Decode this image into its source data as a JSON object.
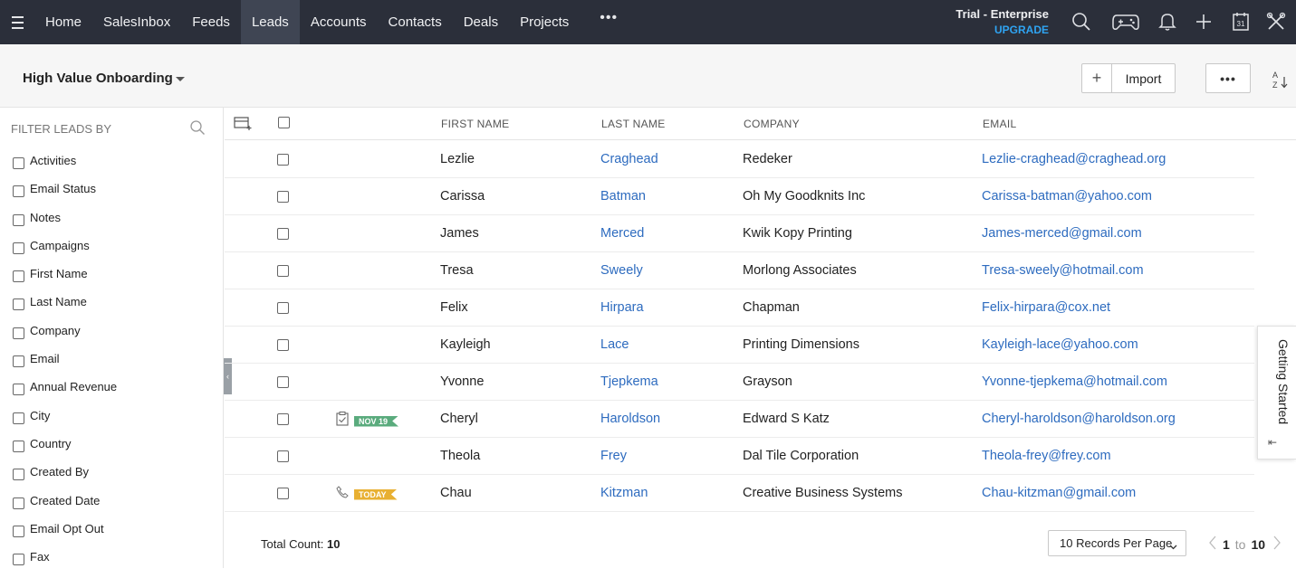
{
  "nav": {
    "items": [
      "Home",
      "SalesInbox",
      "Feeds",
      "Leads",
      "Accounts",
      "Contacts",
      "Deals",
      "Projects"
    ],
    "active": "Leads",
    "more": "•••",
    "trial_label": "Trial - Enterprise",
    "upgrade_label": "UPGRADE",
    "icons": [
      "search-icon",
      "gamepad-icon",
      "bell-icon",
      "plus-icon",
      "calendar-icon",
      "tools-icon"
    ],
    "calendar_day": "31"
  },
  "subheader": {
    "view_name": "High Value Onboarding",
    "plus_label": "+",
    "import_label": "Import",
    "more_label": "•••",
    "sort_top": "A",
    "sort_bottom": "Z"
  },
  "sidebar": {
    "title": "FILTER LEADS BY",
    "filters": [
      "Activities",
      "Email Status",
      "Notes",
      "Campaigns",
      "First Name",
      "Last Name",
      "Company",
      "Email",
      "Annual Revenue",
      "City",
      "Country",
      "Created By",
      "Created Date",
      "Email Opt Out",
      "Fax"
    ]
  },
  "table": {
    "columns": [
      "FIRST NAME",
      "LAST NAME",
      "COMPANY",
      "EMAIL"
    ],
    "rows": [
      {
        "first": "Lezlie",
        "last": "Craghead",
        "company": "Redeker",
        "email": "Lezlie-craghead@craghead.org",
        "activity": null
      },
      {
        "first": "Carissa",
        "last": "Batman",
        "company": "Oh My Goodknits Inc",
        "email": "Carissa-batman@yahoo.com",
        "activity": null
      },
      {
        "first": "James",
        "last": "Merced",
        "company": "Kwik Kopy Printing",
        "email": "James-merced@gmail.com",
        "activity": null
      },
      {
        "first": "Tresa",
        "last": "Sweely",
        "company": "Morlong Associates",
        "email": "Tresa-sweely@hotmail.com",
        "activity": null
      },
      {
        "first": "Felix",
        "last": "Hirpara",
        "company": "Chapman",
        "email": "Felix-hirpara@cox.net",
        "activity": null
      },
      {
        "first": "Kayleigh",
        "last": "Lace",
        "company": "Printing Dimensions",
        "email": "Kayleigh-lace@yahoo.com",
        "activity": null
      },
      {
        "first": "Yvonne",
        "last": "Tjepkema",
        "company": "Grayson",
        "email": "Yvonne-tjepkema@hotmail.com",
        "activity": null
      },
      {
        "first": "Cheryl",
        "last": "Haroldson",
        "company": "Edward S Katz",
        "email": "Cheryl-haroldson@haroldson.org",
        "activity": {
          "icon": "task-icon",
          "tag": "NOV 19",
          "color": "#5aab7d"
        }
      },
      {
        "first": "Theola",
        "last": "Frey",
        "company": "Dal Tile Corporation",
        "email": "Theola-frey@frey.com",
        "activity": null
      },
      {
        "first": "Chau",
        "last": "Kitzman",
        "company": "Creative Business Systems",
        "email": "Chau-kitzman@gmail.com",
        "activity": {
          "icon": "phone-icon",
          "tag": "TODAY",
          "color": "#e8b032"
        }
      }
    ]
  },
  "footer": {
    "total_label": "Total Count:",
    "total_value": "10",
    "per_page": "10 Records Per Page",
    "page_from": "1",
    "page_to_label": "to",
    "page_to": "10"
  },
  "getting_started": {
    "label": "Getting Started"
  },
  "colors": {
    "nav_bg": "#2b2f3a",
    "nav_active_bg": "#3f4553",
    "upgrade": "#2fa4f2",
    "link": "#2d6bbf",
    "tag_green": "#5aab7d",
    "tag_yellow": "#e8b032"
  }
}
